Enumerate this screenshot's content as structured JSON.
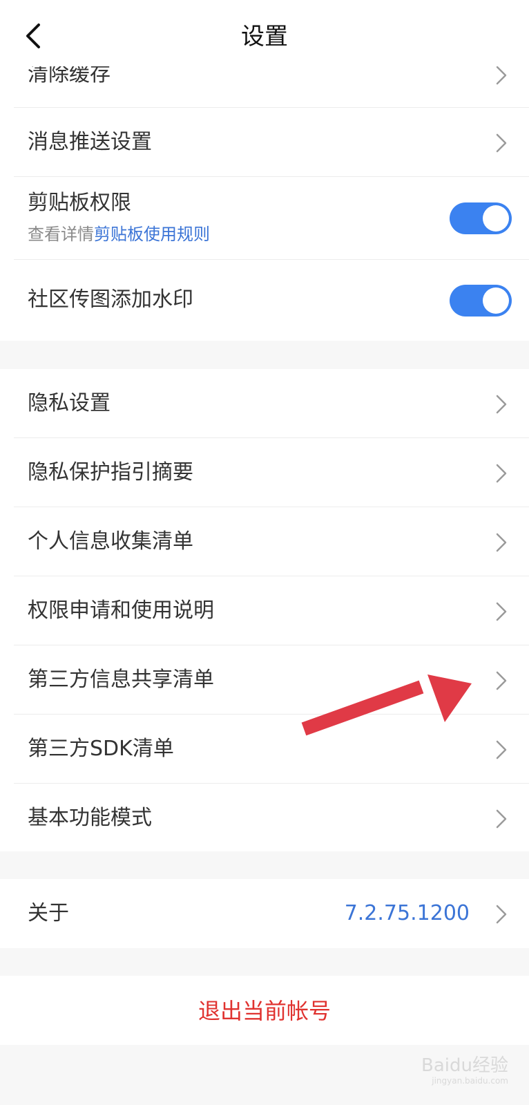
{
  "header": {
    "title": "设置",
    "back_icon": "chevron-left-icon"
  },
  "group1": {
    "items": [
      {
        "label": "清除缓存"
      },
      {
        "label": "消息推送设置"
      }
    ],
    "clipboard": {
      "label": "剪贴板权限",
      "sub_prefix": "查看详情",
      "sub_link": "剪贴板使用规则",
      "enabled": true
    },
    "watermark_toggle": {
      "label": "社区传图添加水印",
      "enabled": true
    }
  },
  "group2": {
    "items": [
      {
        "label": "隐私设置"
      },
      {
        "label": "隐私保护指引摘要"
      },
      {
        "label": "个人信息收集清单"
      },
      {
        "label": "权限申请和使用说明"
      },
      {
        "label": "第三方信息共享清单"
      },
      {
        "label": "第三方SDK清单"
      },
      {
        "label": "基本功能模式"
      }
    ]
  },
  "about": {
    "label": "关于",
    "version": "7.2.75.1200"
  },
  "logout": {
    "label": "退出当前帐号"
  },
  "watermark": {
    "text": "Baidu经验",
    "subtext": "jingyan.baidu.com"
  },
  "colors": {
    "accent": "#3b82f0",
    "link": "#3b74d6",
    "danger": "#e0322f",
    "arrow": "#e03a46"
  }
}
